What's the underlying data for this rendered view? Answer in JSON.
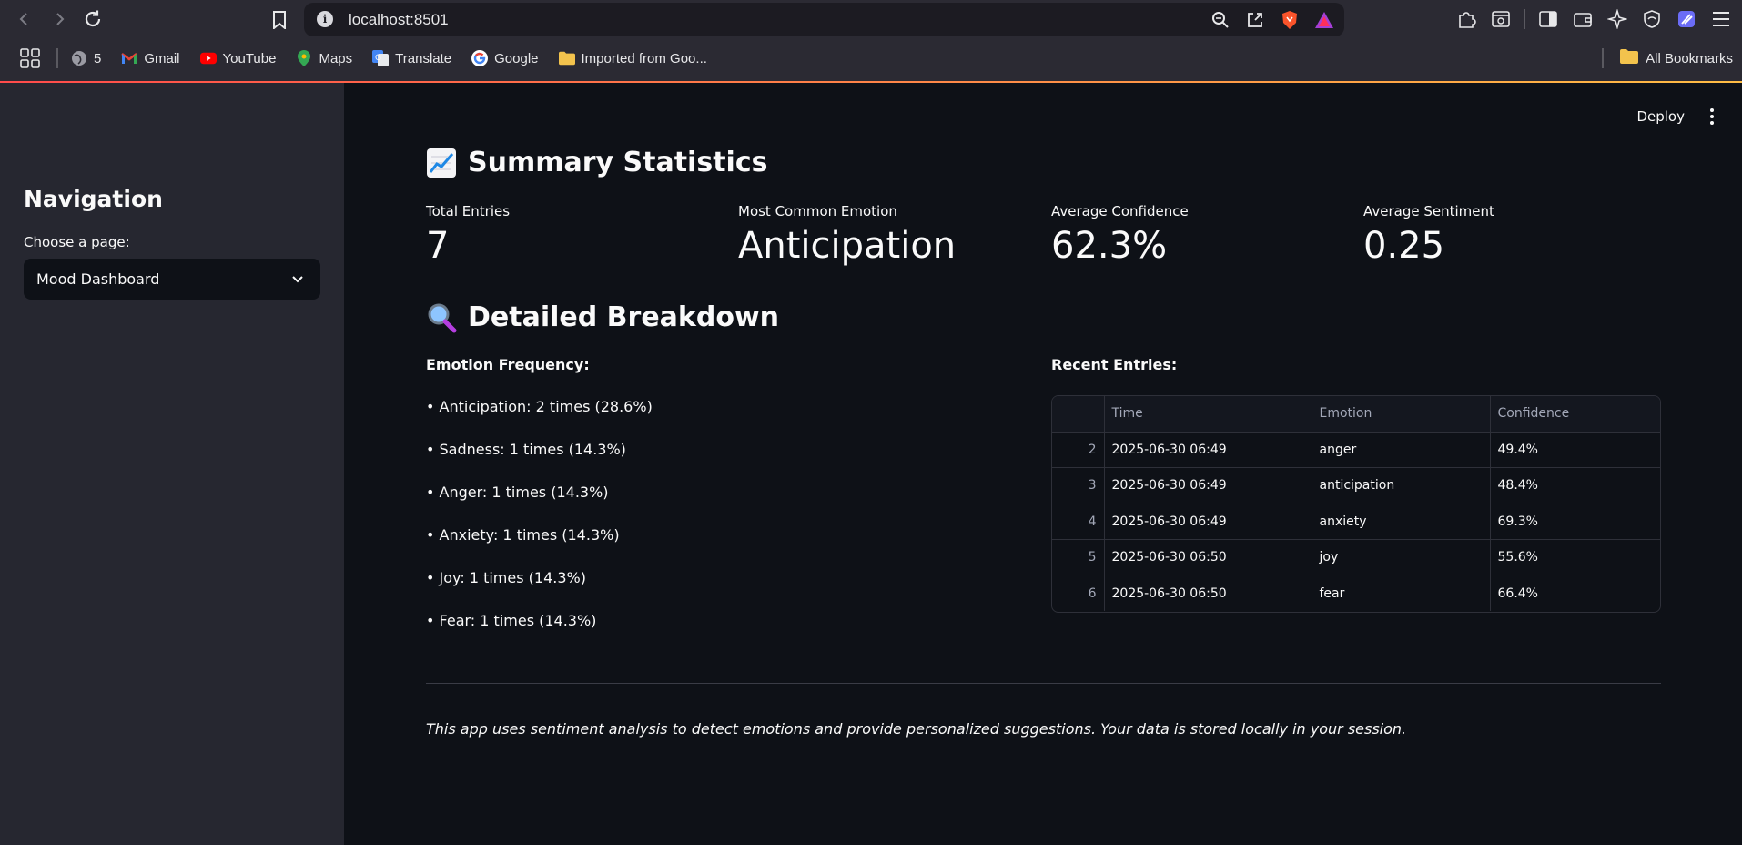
{
  "browser": {
    "url": "localhost:8501",
    "bookmarks": [
      {
        "label": "5",
        "icon": "globe-icon"
      },
      {
        "label": "Gmail",
        "icon": "gmail-icon"
      },
      {
        "label": "YouTube",
        "icon": "youtube-icon"
      },
      {
        "label": "Maps",
        "icon": "maps-icon"
      },
      {
        "label": "Translate",
        "icon": "translate-icon"
      },
      {
        "label": "Google",
        "icon": "google-icon"
      },
      {
        "label": "Imported from Goo...",
        "icon": "folder-icon"
      }
    ],
    "all_bookmarks": "All Bookmarks"
  },
  "sidebar": {
    "title": "Navigation",
    "select_label": "Choose a page:",
    "select_value": "Mood Dashboard"
  },
  "header": {
    "deploy": "Deploy"
  },
  "summary": {
    "title": "Summary Statistics",
    "metrics": [
      {
        "label": "Total Entries",
        "value": "7"
      },
      {
        "label": "Most Common Emotion",
        "value": "Anticipation"
      },
      {
        "label": "Average Confidence",
        "value": "62.3%"
      },
      {
        "label": "Average Sentiment",
        "value": "0.25"
      }
    ]
  },
  "breakdown": {
    "title": "Detailed Breakdown",
    "freq_title": "Emotion Frequency:",
    "freq_items": [
      "• Anticipation: 2 times (28.6%)",
      "• Sadness: 1 times (14.3%)",
      "• Anger: 1 times (14.3%)",
      "• Anxiety: 1 times (14.3%)",
      "• Joy: 1 times (14.3%)",
      "• Fear: 1 times (14.3%)"
    ],
    "recent_title": "Recent Entries:",
    "columns": [
      "",
      "Time",
      "Emotion",
      "Confidence"
    ],
    "rows": [
      [
        "2",
        "2025-06-30 06:49",
        "anger",
        "49.4%"
      ],
      [
        "3",
        "2025-06-30 06:49",
        "anticipation",
        "48.4%"
      ],
      [
        "4",
        "2025-06-30 06:49",
        "anxiety",
        "69.3%"
      ],
      [
        "5",
        "2025-06-30 06:50",
        "joy",
        "55.6%"
      ],
      [
        "6",
        "2025-06-30 06:50",
        "fear",
        "66.4%"
      ]
    ]
  },
  "footer": {
    "note": "This app uses sentiment analysis to detect emotions and provide personalized suggestions. Your data is stored locally in your session."
  }
}
